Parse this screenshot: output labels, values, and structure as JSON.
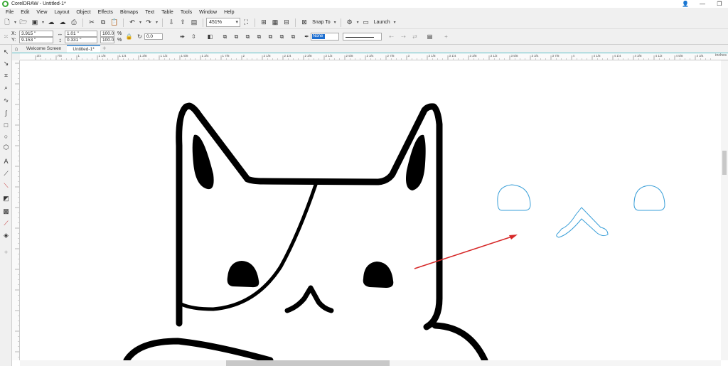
{
  "window": {
    "title": "CorelDRAW - Untitled-1*",
    "controls": [
      "👤",
      "—",
      "❐"
    ]
  },
  "menu": {
    "items": [
      "File",
      "Edit",
      "View",
      "Layout",
      "Object",
      "Effects",
      "Bitmaps",
      "Text",
      "Table",
      "Tools",
      "Window",
      "Help"
    ]
  },
  "toolbar": {
    "zoom": "451%",
    "snap_to": "Snap To",
    "launch": "Launch"
  },
  "property_bar": {
    "x_label": "X:",
    "x_value": "3.915 \"",
    "y_label": "Y:",
    "y_value": "9.153 \"",
    "w_value": "1.01 \"",
    "h_value": "0.331 \"",
    "scale_x": "100.0",
    "scale_y": "100.0",
    "percent": "%",
    "rotation": "0.0",
    "outline_width": "None"
  },
  "tabs": {
    "welcome": "Welcome Screen",
    "document": "Untitled-1*"
  },
  "ruler": {
    "unit": "inches",
    "h_ticks": [
      "3/4",
      "7/8",
      "1",
      "1 1/8",
      "1 1/4",
      "1 3/8",
      "1 1/2",
      "1 5/8",
      "1 3/4",
      "1 7/8",
      "2",
      "2 1/8",
      "2 1/4",
      "2 3/8",
      "2 1/2",
      "2 5/8",
      "2 3/4",
      "2 7/8",
      "3",
      "3 1/8",
      "3 1/4",
      "3 3/8",
      "3 1/2",
      "3 5/8",
      "3 3/4",
      "3 7/8",
      "4",
      "4 1/8",
      "4 1/4",
      "4 3/8",
      "4 1/2",
      "4 5/8",
      "4 3/4"
    ]
  },
  "colors": {
    "accent": "#5b9bd5",
    "selection_outline": "#3a9fd8",
    "arrow": "#d62828",
    "drawing": "#000000",
    "logo": "#3aaa35"
  }
}
